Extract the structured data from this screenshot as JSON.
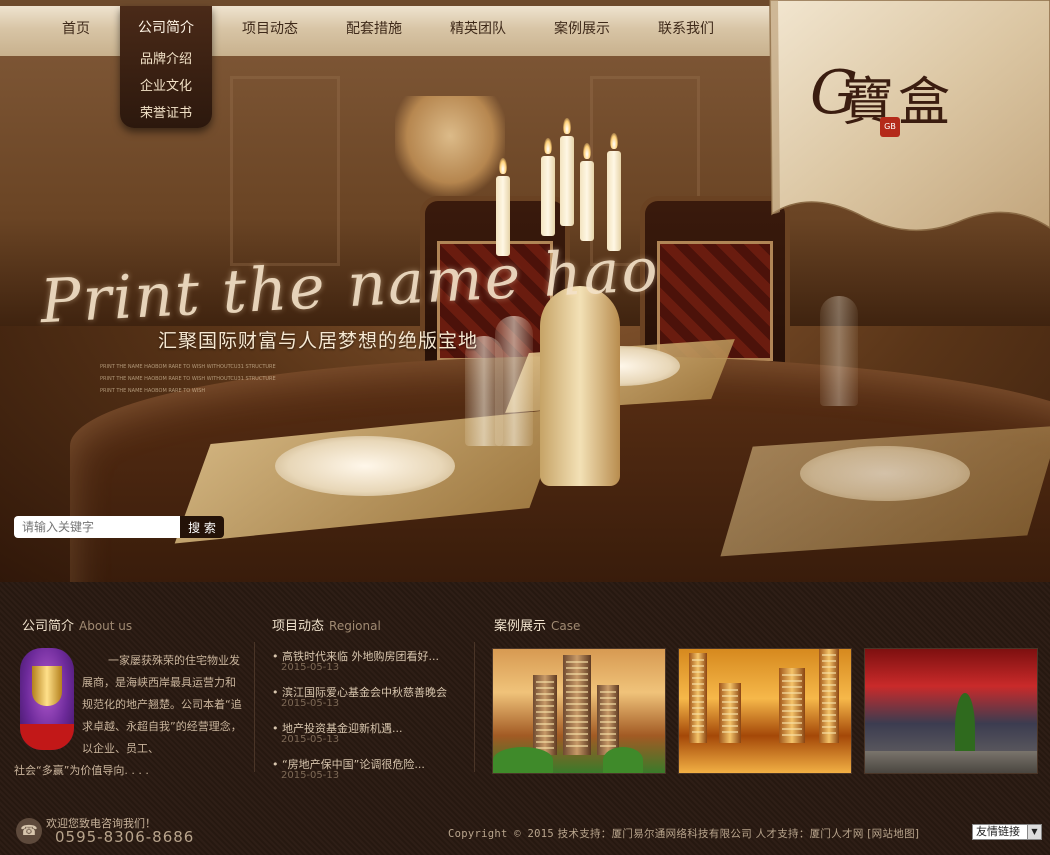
{
  "nav": {
    "items": [
      "首页",
      "公司简介",
      "项目动态",
      "配套措施",
      "精英团队",
      "案例展示",
      "联系我们"
    ],
    "dropdown": [
      "品牌介绍",
      "企业文化",
      "荣誉证书"
    ]
  },
  "logo": {
    "letter": "G",
    "name": "寶盒",
    "seal": "GB"
  },
  "hero": {
    "script": "Print the name hao",
    "tagline": "汇聚国际财富与人居梦想的绝版宝地",
    "fineprint": [
      "PRINT THE NAME HAOBOM RARE TO WISH WITHOUTCU31 STRUCTURE",
      "PRINT THE NAME HAOBOM RARE TO WISH WITHOUTCU31 STRUCTURE",
      "PRINT THE NAME HAOBOM RARE TO WISH"
    ]
  },
  "search": {
    "placeholder": "请输入关键字",
    "button": "搜 索"
  },
  "about": {
    "title": "公司简介",
    "title_en": "About us",
    "text": "一家屡获殊荣的住宅物业发展商，是海峡西岸最具运营力和规范化的地产翘楚。公司本着“追求卓越、永超自我”的经营理念，以企业、员工、",
    "tail": "社会“多赢”为价值导向. . . ."
  },
  "news": {
    "title": "项目动态",
    "title_en": "Regional",
    "items": [
      {
        "title": "• 高铁时代来临  外地购房团看好...",
        "date": "2015-05-13"
      },
      {
        "title": "• 滨江国际爱心基金会中秋慈善晚会",
        "date": "2015-05-13"
      },
      {
        "title": "• 地产投资基金迎新机遇...",
        "date": "2015-05-13"
      },
      {
        "title": "• “房地产保中国”论调很危险...",
        "date": "2015-05-13"
      }
    ]
  },
  "cases": {
    "title": "案例展示",
    "title_en": "Case"
  },
  "footer": {
    "welcome": "欢迎您致电咨询我们！",
    "phone": "0595-8306-8686",
    "copyright": "Copyright © 2015",
    "tech": "技术支持：厦门易尔通网络科技有限公司   人才支持：厦门人才网 [网站地图]",
    "friend_links": "友情链接"
  },
  "icons": {
    "phone": "phone-icon",
    "dropdown_arrow": "chevron-down-icon"
  },
  "colors": {
    "nav_bg": "#d8c5a6",
    "dropdown_bg": "#3a2010",
    "content_bg": "#2a1a12",
    "accent_text": "#f0e2cc"
  }
}
